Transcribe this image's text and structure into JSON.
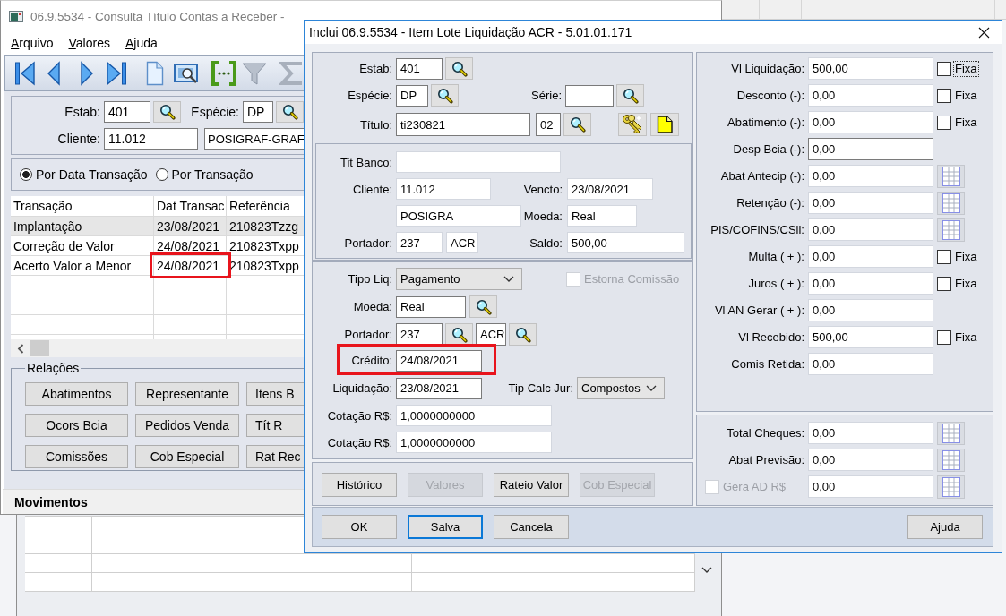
{
  "back_window": {
    "title": "06.9.5534 - Consulta Título Contas a Receber -",
    "menu": [
      "Arquivo",
      "Valores",
      "Ajuda"
    ],
    "filters": {
      "estab": {
        "label": "Estab:",
        "value": "401"
      },
      "especie": {
        "label": "Espécie:",
        "value": "DP"
      },
      "cliente": {
        "label": "Cliente:",
        "value": "11.012",
        "name": "POSIGRAF-GRAF"
      }
    },
    "view_mode": [
      {
        "label": "Por Data Transação",
        "selected": true
      },
      {
        "label": "Por Transação",
        "selected": false
      }
    ],
    "table": {
      "columns": [
        "Transação",
        "Dat Transac",
        "Referência"
      ],
      "rows": [
        {
          "selected": true,
          "cells": [
            {
              "text": "Implantação"
            },
            {
              "text": "23/08/2021"
            },
            {
              "text": "210823Tzzg"
            }
          ]
        },
        {
          "selected": false,
          "cells": [
            {
              "text": "Correção de Valor"
            },
            {
              "text": "24/08/2021"
            },
            {
              "text": "210823Txpp"
            }
          ]
        },
        {
          "selected": false,
          "cells": [
            {
              "text": "Acerto Valor a Menor"
            },
            {
              "text": "24/08/2021",
              "highlighted": true
            },
            {
              "text": "210823Txpp"
            }
          ]
        }
      ]
    },
    "relations": {
      "title": "Relações",
      "buttons": [
        "Abatimentos",
        "Representante",
        "Itens B",
        "Ocors Bcia",
        "Pedidos Venda",
        "Tít R",
        "Comissões",
        "Cob Especial",
        "Rat Rec"
      ]
    },
    "section": {
      "title": "Movimentos"
    }
  },
  "dialog": {
    "title": "Inclui 06.9.5534 - Item Lote Liquidação ACR - 5.01.01.171",
    "titulo": {
      "estab": {
        "label": "Estab:",
        "value": "401"
      },
      "especie": {
        "label": "Espécie:",
        "value": "DP"
      },
      "serie": {
        "label": "Série:"
      },
      "titulo": {
        "label": "Título:",
        "value": "ti230821",
        "parcela": "02"
      }
    },
    "titulo_info": {
      "tit_banco": {
        "label": "Tit Banco:"
      },
      "cliente": {
        "label": "Cliente:",
        "value": "11.012"
      },
      "vencto": {
        "label": "Vencto:",
        "value": "23/08/2021"
      },
      "cliente_nome": "POSIGRA",
      "moeda": {
        "label": "Moeda:",
        "value": "Real"
      },
      "portador": {
        "label": "Portador:",
        "value": "237",
        "carteira": "ACR"
      },
      "saldo": {
        "label": "Saldo:",
        "value": "500,00"
      }
    },
    "liquidacao": {
      "tipo_liq": {
        "label": "Tipo Liq:",
        "value": "Pagamento"
      },
      "estorna_comissao": {
        "label": "Estorna Comissão",
        "checked": false,
        "disabled": true
      },
      "moeda": {
        "label": "Moeda:",
        "value": "Real"
      },
      "portador": {
        "label": "Portador:",
        "value": "237",
        "carteira": "ACR"
      },
      "credito": {
        "label": "Crédito:",
        "value": "24/08/2021",
        "highlighted": true
      },
      "data_liquidacao": {
        "label": "Liquidação:",
        "value": "23/08/2021"
      },
      "tip_calc_jur": {
        "label": "Tip Calc Jur:",
        "value": "Compostos"
      },
      "cotacoes": [
        {
          "label": "Cotação R$:",
          "value": "1,0000000000"
        },
        {
          "label": "Cotação R$:",
          "value": "1,0000000000"
        }
      ]
    },
    "actions": [
      {
        "label": "Histórico",
        "disabled": false
      },
      {
        "label": "Valores",
        "disabled": true
      },
      {
        "label": "Rateio Valor",
        "disabled": false
      },
      {
        "label": "Cob Especial",
        "disabled": true
      }
    ],
    "valores": [
      {
        "kind": "fixa",
        "label": "Vl Liquidação:",
        "value": "500,00",
        "editable": false,
        "option": {
          "label": "Fixa",
          "checked": false,
          "focused": true
        }
      },
      {
        "kind": "fixa",
        "label": "Desconto (-):",
        "value": "0,00",
        "editable": false,
        "option": {
          "label": "Fixa",
          "checked": false,
          "focused": false
        }
      },
      {
        "kind": "fixa",
        "label": "Abatimento (-):",
        "value": "0,00",
        "editable": false,
        "option": {
          "label": "Fixa",
          "checked": false,
          "focused": false
        }
      },
      {
        "kind": "plain",
        "label": "Desp Bcia (-):",
        "value": "0,00",
        "editable": true
      },
      {
        "kind": "grid",
        "label": "Abat Antecip (-):",
        "value": "0,00",
        "editable": false
      },
      {
        "kind": "grid",
        "label": "Retenção (-):",
        "value": "0,00",
        "editable": false
      },
      {
        "kind": "grid",
        "label": "PIS/COFINS/CSll:",
        "value": "0,00",
        "editable": false
      },
      {
        "kind": "fixa",
        "label": "Multa ( + ):",
        "value": "0,00",
        "editable": false,
        "option": {
          "label": "Fixa",
          "checked": false,
          "focused": false
        }
      },
      {
        "kind": "fixa",
        "label": "Juros ( + ):",
        "value": "0,00",
        "editable": false,
        "option": {
          "label": "Fixa",
          "checked": false,
          "focused": false
        }
      },
      {
        "kind": "plain",
        "label": "Vl AN Gerar ( + ):",
        "value": "0,00",
        "editable": false
      },
      {
        "kind": "fixa",
        "label": "Vl Recebido:",
        "value": "500,00",
        "editable": false,
        "option": {
          "label": "Fixa",
          "checked": false,
          "focused": false
        }
      },
      {
        "kind": "plain",
        "label": "Comis Retida:",
        "value": "0,00",
        "editable": false
      }
    ],
    "totais": [
      {
        "kind": "label",
        "label": "Total Cheques:",
        "value": "0,00"
      },
      {
        "kind": "label",
        "label": "Abat Previsão:",
        "value": "0,00"
      },
      {
        "kind": "checkbox",
        "label": "Gera AD R$",
        "value": "0,00",
        "checked": false,
        "disabled": true
      }
    ],
    "buttons": [
      {
        "label": "OK",
        "focused": false
      },
      {
        "label": "Salva",
        "focused": true
      },
      {
        "label": "Cancela",
        "focused": false
      }
    ],
    "help_button": {
      "label": "Ajuda"
    }
  }
}
